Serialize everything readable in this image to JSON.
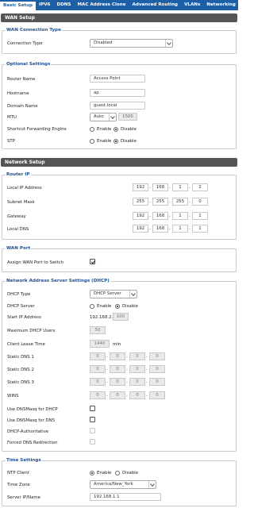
{
  "tabs": [
    "Basic Setup",
    "IPV6",
    "DDNS",
    "MAC Address Clone",
    "Advanced Routing",
    "VLANs",
    "Networking"
  ],
  "wan_setup": {
    "header": "WAN Setup",
    "connection": {
      "legend": "WAN Connection Type",
      "type_label": "Connection Type",
      "type_value": "Disabled"
    },
    "optional": {
      "legend": "Optional Settings",
      "router_name_label": "Router Name",
      "router_name_value": "Access Point",
      "hostname_label": "Hostname",
      "hostname_value": "ap",
      "domain_label": "Domain Name",
      "domain_value": "guest.local",
      "mtu_label": "MTU",
      "mtu_mode": "Auto",
      "mtu_value": "1500",
      "sfe_label": "Shortcut Forwarding Engine",
      "sfe_enable": "Enable",
      "sfe_disable": "Disable",
      "stp_label": "STP",
      "stp_enable": "Enable",
      "stp_disable": "Disable"
    }
  },
  "network_setup": {
    "header": "Network Setup",
    "router_ip": {
      "legend": "Router IP",
      "local_ip_label": "Local IP Address",
      "local_ip": [
        "192",
        "168",
        "1",
        "2"
      ],
      "subnet_label": "Subnet Mask",
      "subnet": [
        "255",
        "255",
        "255",
        "0"
      ],
      "gateway_label": "Gateway",
      "gateway": [
        "192",
        "168",
        "1",
        "1"
      ],
      "dns_label": "Local DNS",
      "dns": [
        "192",
        "168",
        "1",
        "1"
      ]
    },
    "wan_port": {
      "legend": "WAN Port",
      "assign_label": "Assign WAN Port to Switch",
      "assign_checked": true
    },
    "dhcp": {
      "legend": "Network Address Server Settings (DHCP)",
      "type_label": "DHCP Type",
      "type_value": "DHCP Server",
      "server_label": "DHCP Server",
      "server_enable": "Enable",
      "server_disable": "Disable",
      "start_label": "Start IP Address",
      "start_prefix": "192.168.2.",
      "start_value": "100",
      "max_label": "Maximum DHCP Users",
      "max_value": "50",
      "lease_label": "Client Lease Time",
      "lease_value": "1440",
      "lease_unit": "min",
      "dns1_label": "Static DNS 1",
      "dns1": [
        "0",
        "0",
        "0",
        "0"
      ],
      "dns2_label": "Static DNS 2",
      "dns2": [
        "0",
        "0",
        "0",
        "0"
      ],
      "dns3_label": "Static DNS 3",
      "dns3": [
        "0",
        "0",
        "0",
        "0"
      ],
      "wins_label": "WINS",
      "wins": [
        "0",
        "0",
        "0",
        "0"
      ],
      "dnsmasq_dhcp_label": "Use DNSMasq for DHCP",
      "dnsmasq_dns_label": "Use DNSMasq for DNS",
      "authoritative_label": "DHCP-Authoritative",
      "forced_dns_label": "Forced DNS Redirection"
    },
    "time": {
      "legend": "Time Settings",
      "ntp_label": "NTP Client",
      "ntp_enable": "Enable",
      "ntp_disable": "Disable",
      "tz_label": "Time Zone",
      "tz_value": "America/New_York",
      "server_label": "Server IP/Name",
      "server_value": "192.168.1.1"
    }
  },
  "colors": {
    "tab_bar": "#1d5fa6",
    "section_header": "#555555",
    "legend_text": "#1d4f95"
  }
}
